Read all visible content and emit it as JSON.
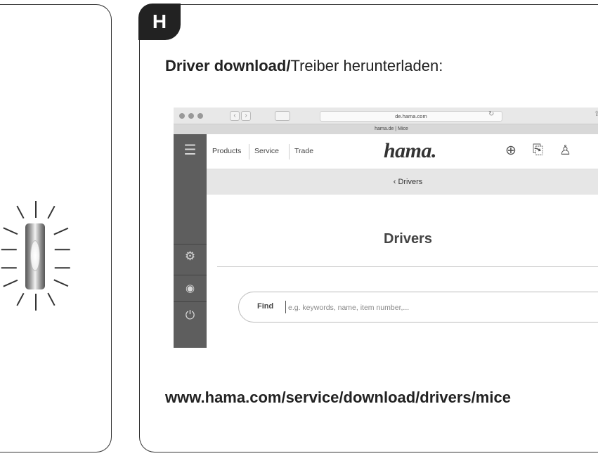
{
  "step": {
    "badge": "H"
  },
  "heading": {
    "bold": "Driver download",
    "separator": "/",
    "normal": "Treiber herunterladen:"
  },
  "browser": {
    "address": "de.hama.com",
    "tab_title": "hama.de | Mice",
    "nav_links": [
      "Products",
      "Service",
      "Trade"
    ],
    "logo": "hama.",
    "breadcrumb": "‹ Drivers",
    "page_title": "Drivers",
    "search": {
      "label": "Find",
      "placeholder": "e.g. keywords, name, item number,..."
    }
  },
  "download_url": "www.hama.com/service/download/drivers/mice",
  "icons": [
    "led-light-icon",
    "menu-icon",
    "globe-icon",
    "clipboard-icon",
    "user-icon",
    "settings-icon",
    "eye-icon",
    "power-icon"
  ]
}
